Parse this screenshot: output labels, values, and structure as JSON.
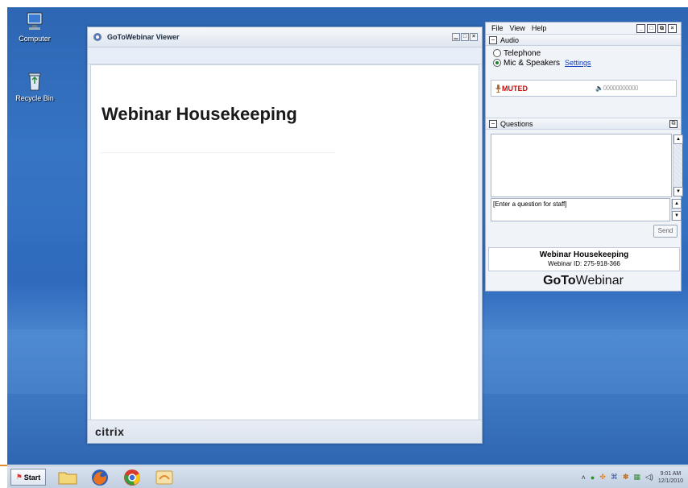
{
  "desktop": {
    "icons": [
      {
        "label": "Computer"
      },
      {
        "label": "Recycle Bin"
      }
    ]
  },
  "viewer": {
    "title": "GoToWebinar Viewer",
    "slide_title": "Webinar Housekeeping",
    "footer_brand": "citrix"
  },
  "panel": {
    "menu": [
      "File",
      "View",
      "Help"
    ],
    "audio": {
      "header": "Audio",
      "options": [
        "Telephone",
        "Mic & Speakers"
      ],
      "selected": "Mic & Speakers",
      "settings_link": "Settings",
      "muted_label": "MUTED",
      "volume_meter": "00000000000"
    },
    "questions": {
      "header": "Questions",
      "placeholder": "[Enter a question for staff]",
      "send_label": "Send"
    },
    "info": {
      "title": "Webinar Housekeeping",
      "webinar_id": "Webinar ID: 275-918-366"
    },
    "brand": {
      "goto": "GoTo",
      "webinar": "Webinar"
    }
  },
  "taskbar": {
    "start_label": "Start",
    "clock_time": "9:01 AM",
    "clock_date": "12/1/2010"
  },
  "colors": {
    "desktop_blue": "#2f6abd",
    "muted_red": "#dd0000",
    "link_blue": "#0a3cc2"
  }
}
